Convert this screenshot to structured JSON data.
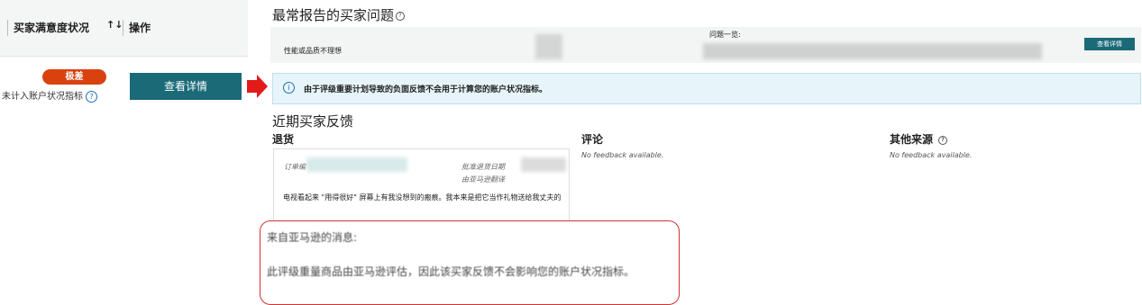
{
  "left_panel": {
    "header": {
      "column_title": "买家满意度状况",
      "sort_icon": "↑↓",
      "actions_title": "操作"
    },
    "status_badge": "极差",
    "not_counted_text": "未计入账户状况指标",
    "view_details_button": "查看详情"
  },
  "top_issues": {
    "title": "最常报告的买家问题",
    "issue_label": "性能或品质不理想",
    "issue_list_label": "问题一览:",
    "view_details_button": "查看详情"
  },
  "info_banner": {
    "text": "由于评级重要计划导致的负面反馈不会用于计算您的账户状况指标。"
  },
  "recent_feedback": {
    "title": "近期买家反馈",
    "columns": {
      "returns": {
        "title": "退货",
        "order_label": "订单编",
        "approved_date_label": "批准退货日期",
        "translated_label": "由亚马逊翻译",
        "comment": "电视看起来 \"用得很好\" 屏幕上有我没想到的瘢痕。我本来是把它当作礼物送给我丈夫的"
      },
      "comments": {
        "title": "评论",
        "empty_text": "No feedback available."
      },
      "other_sources": {
        "title": "其他来源",
        "empty_text": "No feedback available."
      }
    }
  },
  "amazon_message": {
    "heading": "来自亚马逊的消息:",
    "body": "此评级重量商品由亚马逊评估，因此该买家反馈不会影响您的账户状况指标。"
  },
  "colors": {
    "accent_teal": "#1a6a78",
    "badge_red": "#d9420f",
    "annotation_red": "#d23232",
    "info_blue_bg": "#e7f4fa"
  }
}
